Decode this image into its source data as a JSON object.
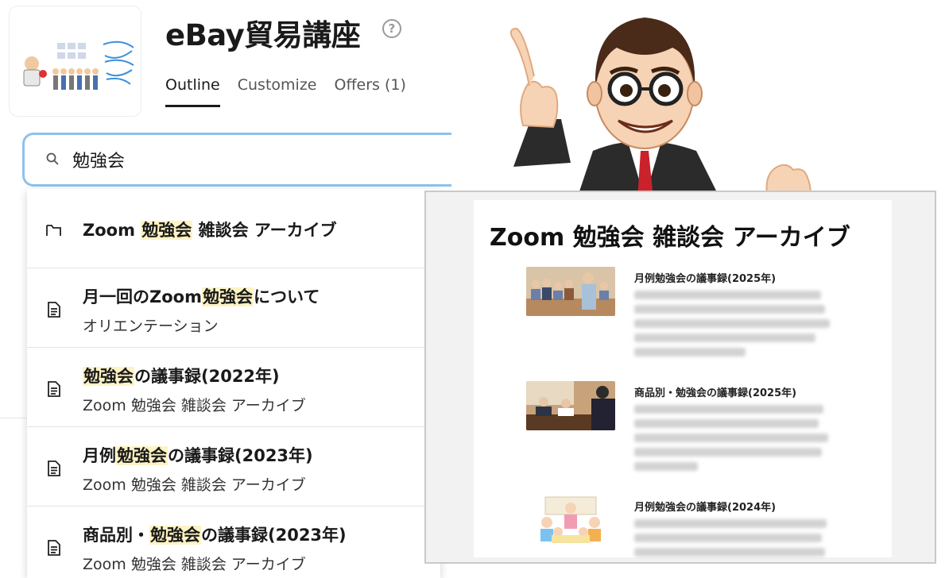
{
  "course": {
    "title": "eBay貿易講座",
    "help_icon": "question-circle-icon",
    "thumbnail": "course-thumbnail"
  },
  "tabs": [
    {
      "label": "Outline",
      "active": true
    },
    {
      "label": "Customize",
      "active": false
    },
    {
      "label": "Offers (1)",
      "active": false
    }
  ],
  "search": {
    "value": "勉強会",
    "icon": "search-icon",
    "focus_color": "#8cc2ee"
  },
  "highlight_color": "#fff3c4",
  "results": [
    {
      "type": "folder",
      "icon": "folder-icon",
      "title_pre": "Zoom ",
      "title_match": "勉強会",
      "title_post": " 雑談会 アーカイブ",
      "subtitle": ""
    },
    {
      "type": "lesson",
      "icon": "lesson-doc-icon",
      "title_pre": "月一回のZoom",
      "title_match": "勉強会",
      "title_post": "について",
      "subtitle": "オリエンテーション"
    },
    {
      "type": "lesson",
      "icon": "lesson-doc-icon",
      "title_pre": "",
      "title_match": "勉強会",
      "title_post": "の議事録(2022年)",
      "subtitle": "Zoom 勉強会 雑談会 アーカイブ"
    },
    {
      "type": "lesson",
      "icon": "lesson-doc-icon",
      "title_pre": "月例",
      "title_match": "勉強会",
      "title_post": "の議事録(2023年)",
      "subtitle": "Zoom 勉強会 雑談会 アーカイブ"
    },
    {
      "type": "lesson",
      "icon": "lesson-doc-icon",
      "title_pre": "商品別・",
      "title_match": "勉強会",
      "title_post": "の議事録(2023年)",
      "subtitle": "Zoom 勉強会 雑談会 アーカイブ"
    }
  ],
  "preview": {
    "title": "Zoom 勉強会 雑談会 アーカイブ",
    "items": [
      {
        "title": "月例勉強会の議事録(2025年)",
        "image": "classroom-lecture-photo"
      },
      {
        "title": "商品別・勉強会の議事録(2025年)",
        "image": "meeting-discussion-photo"
      },
      {
        "title": "月例勉強会の議事録(2024年)",
        "image": "cartoon-people-meeting"
      }
    ]
  },
  "illustration": "pointing-teacher-mascot"
}
